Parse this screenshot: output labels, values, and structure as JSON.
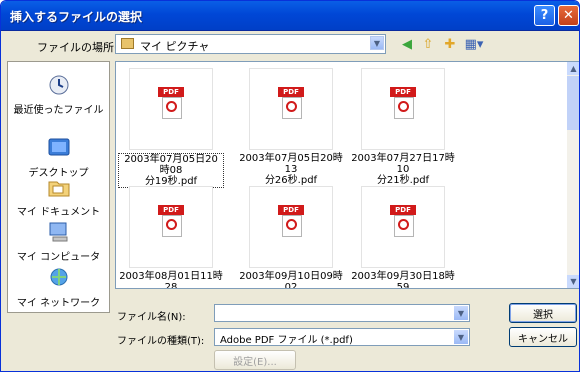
{
  "window": {
    "title": "挿入するファイルの選択"
  },
  "toolbar": {
    "look_in_label": "ファイルの場所(I):",
    "look_in_value": "マイ ピクチャ"
  },
  "places": [
    {
      "label": "最近使ったファイル",
      "icon": "recent-files-icon"
    },
    {
      "label": "デスクトップ",
      "icon": "desktop-icon"
    },
    {
      "label": "マイ ドキュメント",
      "icon": "my-documents-icon"
    },
    {
      "label": "マイ コンピュータ",
      "icon": "my-computer-icon"
    },
    {
      "label": "マイ ネットワーク",
      "icon": "my-network-icon"
    }
  ],
  "files": [
    {
      "name_line1": "2003年07月05日20時08",
      "name_line2": "分19秒.pdf",
      "selected": true
    },
    {
      "name_line1": "2003年07月05日20時13",
      "name_line2": "分26秒.pdf",
      "selected": false
    },
    {
      "name_line1": "2003年07月27日17時10",
      "name_line2": "分21秒.pdf",
      "selected": false
    },
    {
      "name_line1": "2003年08月01日11時28",
      "name_line2": "",
      "selected": false
    },
    {
      "name_line1": "2003年09月10日09時02",
      "name_line2": "",
      "selected": false
    },
    {
      "name_line1": "2003年09月30日18時59",
      "name_line2": "",
      "selected": false
    }
  ],
  "pdf_icon": {
    "tag": "PDF",
    "brand": "Adobe"
  },
  "bottom": {
    "filename_label": "ファイル名(N):",
    "filename_value": "",
    "filetype_label": "ファイルの種類(T):",
    "filetype_value": "Adobe PDF ファイル (*.pdf)",
    "ok_label": "選択",
    "cancel_label": "キャンセル",
    "settings_label": "設定(E)..."
  }
}
